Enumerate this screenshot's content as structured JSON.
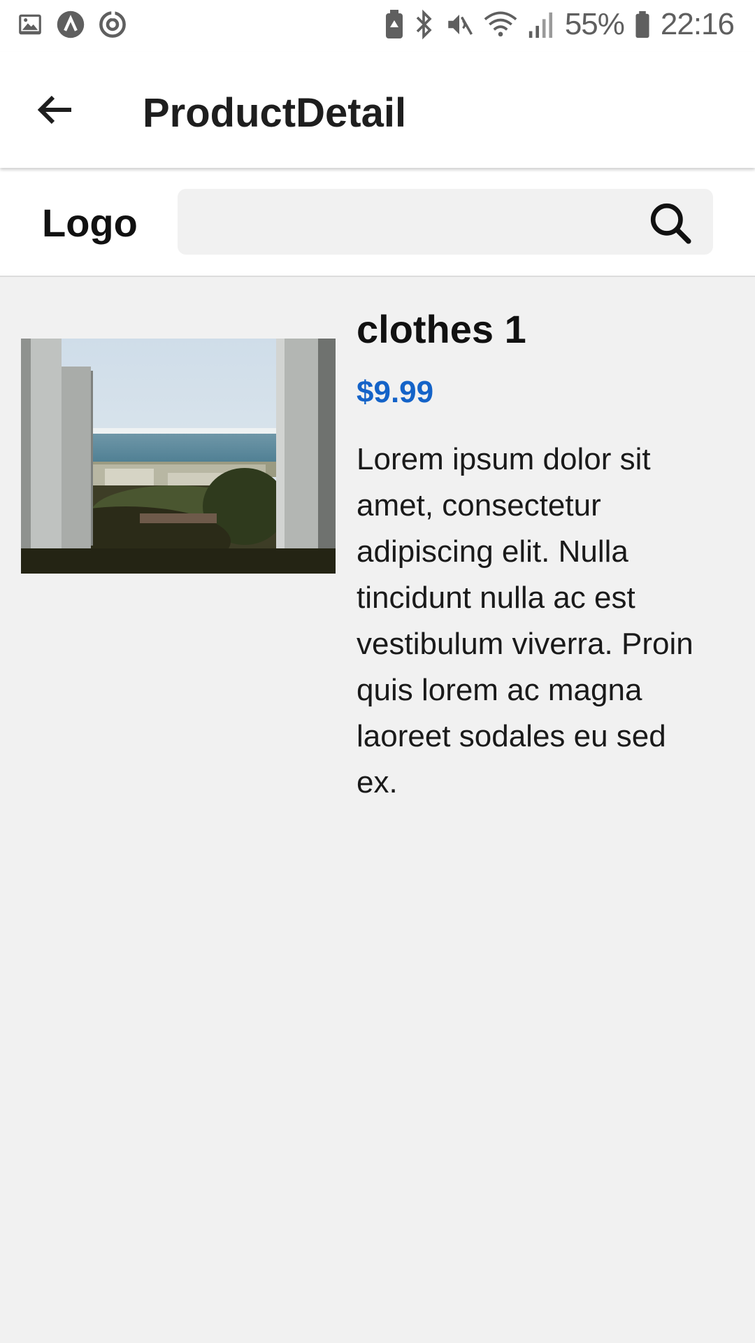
{
  "status_bar": {
    "battery_percent": "55%",
    "time": "22:16",
    "left_icons": [
      "image-icon",
      "app-icon",
      "sync-icon"
    ],
    "right_icons": [
      "battery-saver-icon",
      "bluetooth-icon",
      "mute-icon",
      "wifi-icon",
      "signal-icon",
      "battery-icon"
    ]
  },
  "app_bar": {
    "title": "ProductDetail",
    "back_icon": "arrow-left-icon"
  },
  "header": {
    "logo": "Logo",
    "search": {
      "value": "",
      "placeholder": ""
    },
    "search_icon": "search-icon"
  },
  "product": {
    "name": "clothes 1",
    "price": "$9.99",
    "description": "Lorem ipsum dolor sit amet, consectetur adipiscing elit. Nulla tincidunt nulla ac est vestibulum viverra. Proin quis lorem ac magna laoreet sodales eu sed ex."
  },
  "colors": {
    "price": "#1463c8",
    "background": "#f1f1f1",
    "surface": "#ffffff"
  }
}
